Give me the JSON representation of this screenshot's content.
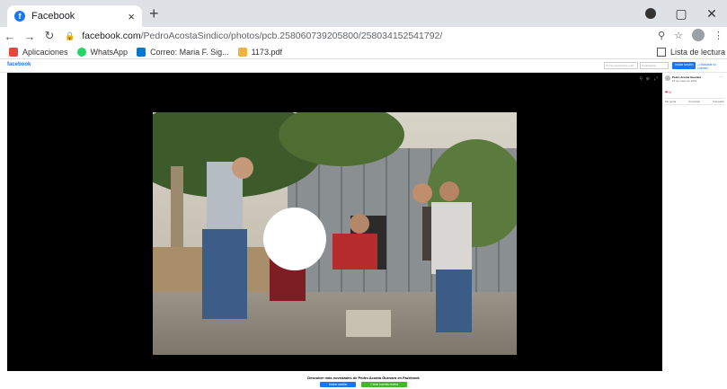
{
  "browser": {
    "tab_title": "Facebook",
    "tab_close": "×",
    "new_tab": "+",
    "url_domain": "facebook.com",
    "url_path": "/PedroAcostaSindico/photos/pcb.258060739205800/258034152541792/",
    "window_controls": [
      "–",
      "▢",
      "✕"
    ]
  },
  "bookmarks": {
    "items": [
      {
        "label": "Aplicaciones",
        "icon": "apps-grid-icon",
        "color": "#e8453c"
      },
      {
        "label": "WhatsApp",
        "icon": "whatsapp-icon",
        "color": "#25d366"
      },
      {
        "label": "Correo: Maria F. Sig...",
        "icon": "outlook-icon",
        "color": "#0078d4"
      },
      {
        "label": "1173.pdf",
        "icon": "pdf-icon",
        "color": "#f2b33d"
      }
    ],
    "reading_list": "Lista de lectura"
  },
  "facebook": {
    "logo": "facebook",
    "email_placeholder": "Correo electrónico o tel.",
    "password_placeholder": "Contraseña",
    "login_button": "Iniciar sesión",
    "forgot_link": "¿Olvidaste tu cuenta?"
  },
  "post": {
    "author": "Pedro Acosta Guevara",
    "date": "15 de mayo de 2021 · ",
    "reactions": "❤ 8",
    "actions": [
      "Me gusta",
      "Comentar",
      "Compartir"
    ]
  },
  "footer": {
    "message": "Descubre más novedades de Pedro Acosta Guevara en Facebook",
    "login_button": "Iniciar sesión",
    "signup_button": "Crear cuenta nueva"
  },
  "colors": {
    "brand": "#1877f2",
    "signup": "#42b72a",
    "viewer_bg": "#000000"
  }
}
